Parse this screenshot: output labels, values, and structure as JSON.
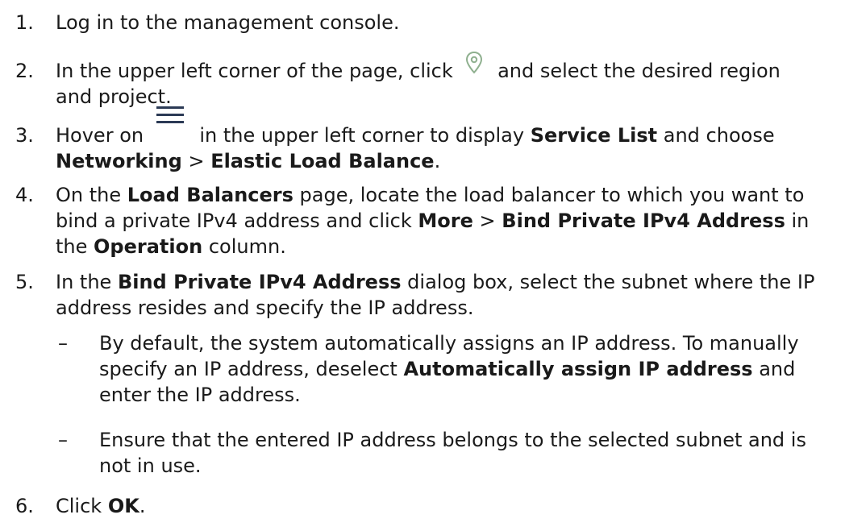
{
  "steps": [
    {
      "num": "1.",
      "text": "Log in to the management console."
    },
    {
      "num": "2.",
      "text_a": "In the upper left corner of the page, click",
      "icon": "location-pin-icon",
      "text_b": "and select the desired region",
      "text_c": "and project."
    },
    {
      "num": "3.",
      "text_a": "Hover on",
      "icon": "hamburger-menu-icon",
      "text_b": "in the upper left corner to display",
      "bold_a": "Service List",
      "text_c": "and choose",
      "bold_b": "Networking",
      "text_d": ">",
      "bold_c": "Elastic Load Balance",
      "text_e": "."
    },
    {
      "num": "4.",
      "text_a": "On the",
      "bold_a": "Load Balancers",
      "text_b": "page, locate the load balancer to which you want to",
      "text_c": "bind a private IPv4 address and click",
      "bold_b": "More",
      "text_d": ">",
      "bold_c": "Bind Private IPv4 Address",
      "text_e": "in",
      "text_f": "the",
      "bold_d": "Operation",
      "text_g": "column."
    },
    {
      "num": "5.",
      "text_a": "In the",
      "bold_a": "Bind Private IPv4 Address",
      "text_b": "dialog box, select the subnet where the IP",
      "text_c": "address resides and specify the IP address.",
      "subitems": [
        {
          "dash": "–",
          "line1": "By default, the system automatically assigns an IP address. To manually",
          "line2a": "specify an IP address, deselect",
          "line2bold": "Automatically assign IP address",
          "line2b": "and",
          "line3": "enter the IP address."
        },
        {
          "dash": "–",
          "line1": "Ensure that the entered IP address belongs to the selected subnet and is",
          "line2": "not in use."
        }
      ]
    },
    {
      "num": "6.",
      "text_a": "Click",
      "bold_a": "OK",
      "text_b": "."
    }
  ],
  "colors": {
    "text": "#1a1a1a",
    "icon_pin": "#8fb08f",
    "icon_menu": "#2b3a55"
  }
}
